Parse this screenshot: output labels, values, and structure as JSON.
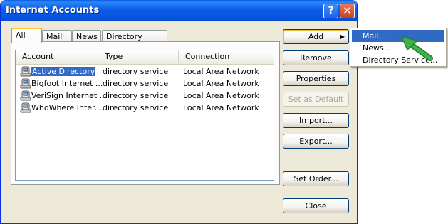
{
  "window": {
    "title": "Internet Accounts",
    "help_label": "?",
    "close_label": "✕"
  },
  "tabs": [
    "All",
    "Mail",
    "News",
    "Directory Service"
  ],
  "columns": [
    "Account",
    "Type",
    "Connection"
  ],
  "rows": [
    {
      "account": "Active Directory",
      "type": "directory service",
      "connection": "Local Area Network",
      "icon": "directory-service-icon"
    },
    {
      "account": "Bigfoot Internet ...",
      "type": "directory service",
      "connection": "Local Area Network",
      "icon": "directory-service-icon"
    },
    {
      "account": "VeriSign Internet ...",
      "type": "directory service",
      "connection": "Local Area Network",
      "icon": "directory-service-icon"
    },
    {
      "account": "WhoWhere Inter...",
      "type": "directory service",
      "connection": "Local Area Network",
      "icon": "directory-service-icon"
    }
  ],
  "buttons": {
    "add": "Add",
    "remove": "Remove",
    "properties": "Properties",
    "set_default": "Set as Default",
    "import": "Import...",
    "export": "Export...",
    "set_order": "Set Order...",
    "close": "Close"
  },
  "add_menu": [
    "Mail...",
    "News...",
    "Directory Service..."
  ],
  "colors": {
    "selection": "#316ac5",
    "pointer": "#3bb54a",
    "titlebar": "#0a5ee6"
  }
}
